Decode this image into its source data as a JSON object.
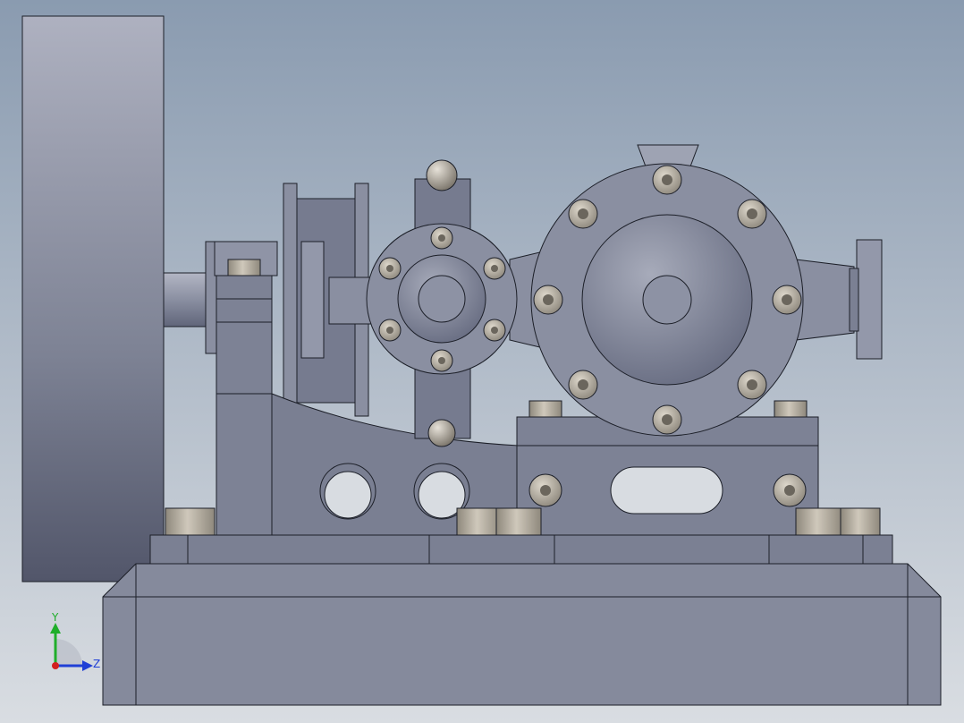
{
  "viewport": {
    "background_top": "#8a9bb0",
    "background_bottom": "#d9dde2"
  },
  "model": {
    "metal_light": "#9ea3b3",
    "metal_mid": "#7f8597",
    "metal_dark": "#5c6173",
    "bolt_color": "#b9b2a5",
    "edge_color": "#1c1f28"
  },
  "triad": {
    "y_label": "Y",
    "z_label": "Z",
    "y_color": "#1fae2a",
    "z_color": "#1f3fd6",
    "x_color": "#d3201f"
  }
}
